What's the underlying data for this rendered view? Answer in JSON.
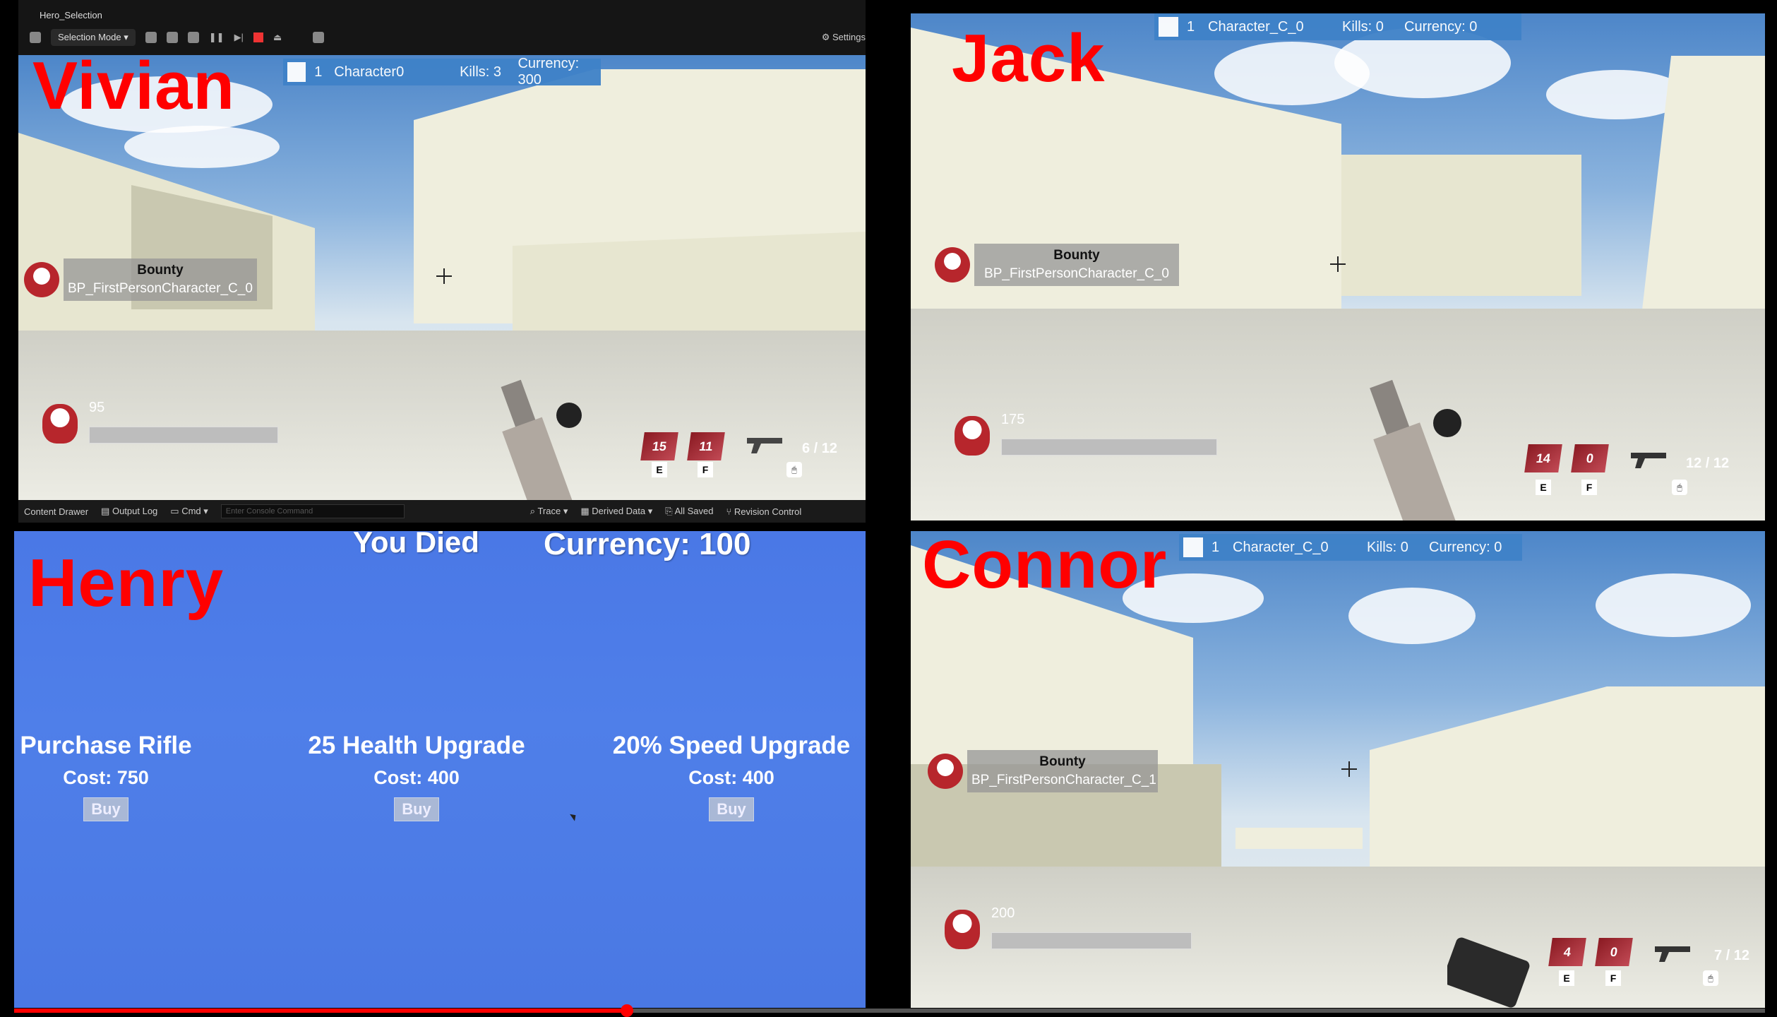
{
  "editor": {
    "tab_title": "Hero_Selection",
    "selection_mode": "Selection Mode",
    "settings": "Settings",
    "content_drawer": "Content Drawer",
    "output_log": "Output Log",
    "cmd": "Cmd",
    "console_placeholder": "Enter Console Command",
    "trace": "Trace",
    "derived_data": "Derived Data",
    "all_saved": "All Saved",
    "revision_control": "Revision Control"
  },
  "vivian": {
    "name": "Vivian",
    "score": {
      "rank": "1",
      "character": "Character0",
      "kills": "Kills: 3",
      "currency": "Currency: 300"
    },
    "bounty": {
      "title": "Bounty",
      "target": "BP_FirstPersonCharacter_C_0"
    },
    "health": "95",
    "ability_e": "15",
    "ability_f": "11",
    "key_e": "E",
    "key_f": "F",
    "ammo": "6 / 12"
  },
  "jack": {
    "name": "Jack",
    "score": {
      "rank": "1",
      "character": "Character_C_0",
      "kills": "Kills: 0",
      "currency": "Currency: 0"
    },
    "bounty": {
      "title": "Bounty",
      "target": "BP_FirstPersonCharacter_C_0"
    },
    "health": "175",
    "ability_e": "14",
    "ability_f": "0",
    "key_e": "E",
    "key_f": "F",
    "ammo": "12 / 12"
  },
  "henry": {
    "name": "Henry",
    "died": "You Died",
    "currency": "Currency: 100",
    "items": [
      {
        "name": "Purchase Rifle",
        "cost": "Cost: 750",
        "button": "Buy"
      },
      {
        "name": "25 Health Upgrade",
        "cost": "Cost: 400",
        "button": "Buy"
      },
      {
        "name": "20% Speed Upgrade",
        "cost": "Cost: 400",
        "button": "Buy"
      }
    ]
  },
  "connor": {
    "name": "Connor",
    "score": {
      "rank": "1",
      "character": "Character_C_0",
      "kills": "Kills: 0",
      "currency": "Currency: 0"
    },
    "bounty": {
      "title": "Bounty",
      "target": "BP_FirstPersonCharacter_C_1"
    },
    "health": "200",
    "ability_e": "4",
    "ability_f": "0",
    "key_e": "E",
    "key_f": "F",
    "ammo": "7 / 12"
  },
  "video": {
    "progress": 0.35
  },
  "colors": {
    "name_red": "#ff0000",
    "score_blue": "#3f82c8",
    "shop_blue": "#4f7fe9"
  }
}
